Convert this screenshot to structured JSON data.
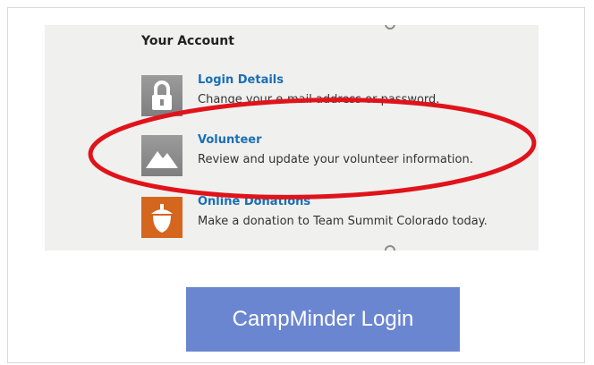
{
  "account": {
    "title": "Your Account",
    "items": [
      {
        "title": "Login Details",
        "description": "Change your e-mail address or password.",
        "icon": "lock-icon"
      },
      {
        "title": "Volunteer",
        "description": "Review and update your volunteer information.",
        "icon": "mountain-icon"
      },
      {
        "title": "Online Donations",
        "description": "Make a donation to Team Summit Colorado today.",
        "icon": "acorn-icon"
      }
    ]
  },
  "annotation": {
    "shape": "ellipse",
    "color": "#e0131b"
  },
  "button": {
    "label": "CampMinder Login",
    "color": "#6b86d1"
  }
}
